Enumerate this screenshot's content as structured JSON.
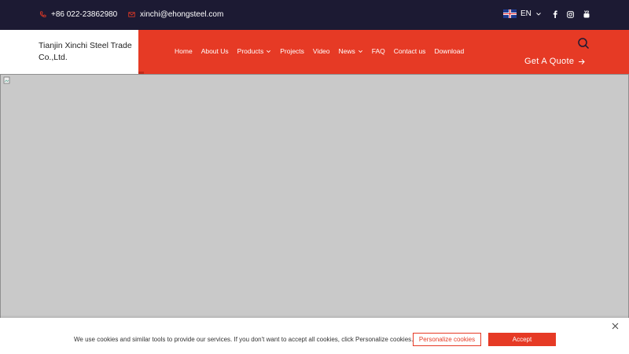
{
  "topbar": {
    "phone": "+86 022-23862980",
    "email": "xinchi@ehongsteel.com",
    "language": "EN",
    "phone_icon": "phone-icon",
    "mail_icon": "mail-icon",
    "socials": [
      "facebook-icon",
      "instagram-icon",
      "youtube-icon"
    ]
  },
  "header": {
    "logo_text": "Tianjin Xinchi Steel Trade Co.,Ltd.",
    "nav": [
      {
        "label": "Home"
      },
      {
        "label": "About Us"
      },
      {
        "label": "Products"
      },
      {
        "label": "Projects"
      },
      {
        "label": "Video"
      },
      {
        "label": "News"
      },
      {
        "label": "FAQ"
      },
      {
        "label": "Contact us"
      },
      {
        "label": "Download"
      }
    ],
    "quote_label": "Get A Quote"
  },
  "cookie_banner": {
    "text": "We use cookies and similar tools to provide our services. If you don't want to accept all cookies, click Personalize cookies.",
    "personalize_label": "Personalize cookies",
    "accept_label": "Accept"
  },
  "colors": {
    "accent": "#e63a25",
    "topbar_bg": "#1c1a33",
    "banner_placeholder": "#c9c9c9"
  }
}
